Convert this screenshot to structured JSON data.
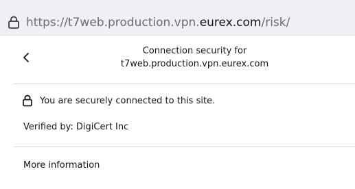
{
  "urlbar": {
    "lock_icon": "lock-icon",
    "url_prefix": "https://t7web.production.vpn.",
    "url_domain": "eurex.com",
    "url_suffix": "/risk/"
  },
  "panel": {
    "back_icon": "chevron-left-icon",
    "title_line1": "Connection security for",
    "title_line2": "t7web.production.vpn.eurex.com",
    "secure_icon": "lock-icon",
    "secure_text": "You are securely connected to this site.",
    "verified_text": "Verified by: DigiCert Inc",
    "more_info": "More information"
  }
}
